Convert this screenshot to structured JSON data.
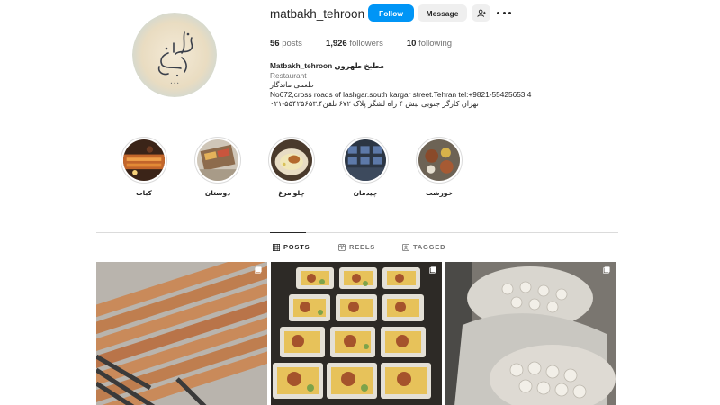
{
  "profile": {
    "username": "matbakh_tehroon",
    "follow_label": "Follow",
    "message_label": "Message",
    "stats": {
      "posts_count": "56",
      "posts_label": "posts",
      "followers_count": "1,926",
      "followers_label": "followers",
      "following_count": "10",
      "following_label": "following"
    },
    "bio": {
      "name": "Matbakh_tehroon مطبخ طهرون",
      "category": "Restaurant",
      "line1": "طعمی ماندگار",
      "line2": "No672,cross roads of lashgar.south kargar street.Tehran tel:+9821-55425653.4",
      "line3": "تهران کارگر جنوبی نبش ۴ راه لشگر پلاک ۶۷۲ تلفن۵۵۴۲۵۶۵۳.۴-۰۲۱"
    },
    "avatar": {
      "logo_text": "مطبخ طهرون"
    }
  },
  "highlights": [
    {
      "label": "کباب",
      "icon": "kebab-grill"
    },
    {
      "label": "دوستان",
      "icon": "friends-food"
    },
    {
      "label": "چلو مرغ",
      "icon": "chicken-rice"
    },
    {
      "label": "چیدمان",
      "icon": "trays-arrangement"
    },
    {
      "label": "خورشت",
      "icon": "stew-table"
    }
  ],
  "tabs": [
    {
      "label": "POSTS",
      "icon": "grid-icon",
      "active": true
    },
    {
      "label": "REELS",
      "icon": "reels-icon",
      "active": false
    },
    {
      "label": "TAGGED",
      "icon": "tagged-icon",
      "active": false
    }
  ],
  "colors": {
    "accent": "#0095f6",
    "secondary_button": "#efefef",
    "text": "#262626",
    "muted": "#737373",
    "border": "#dbdbdb"
  }
}
